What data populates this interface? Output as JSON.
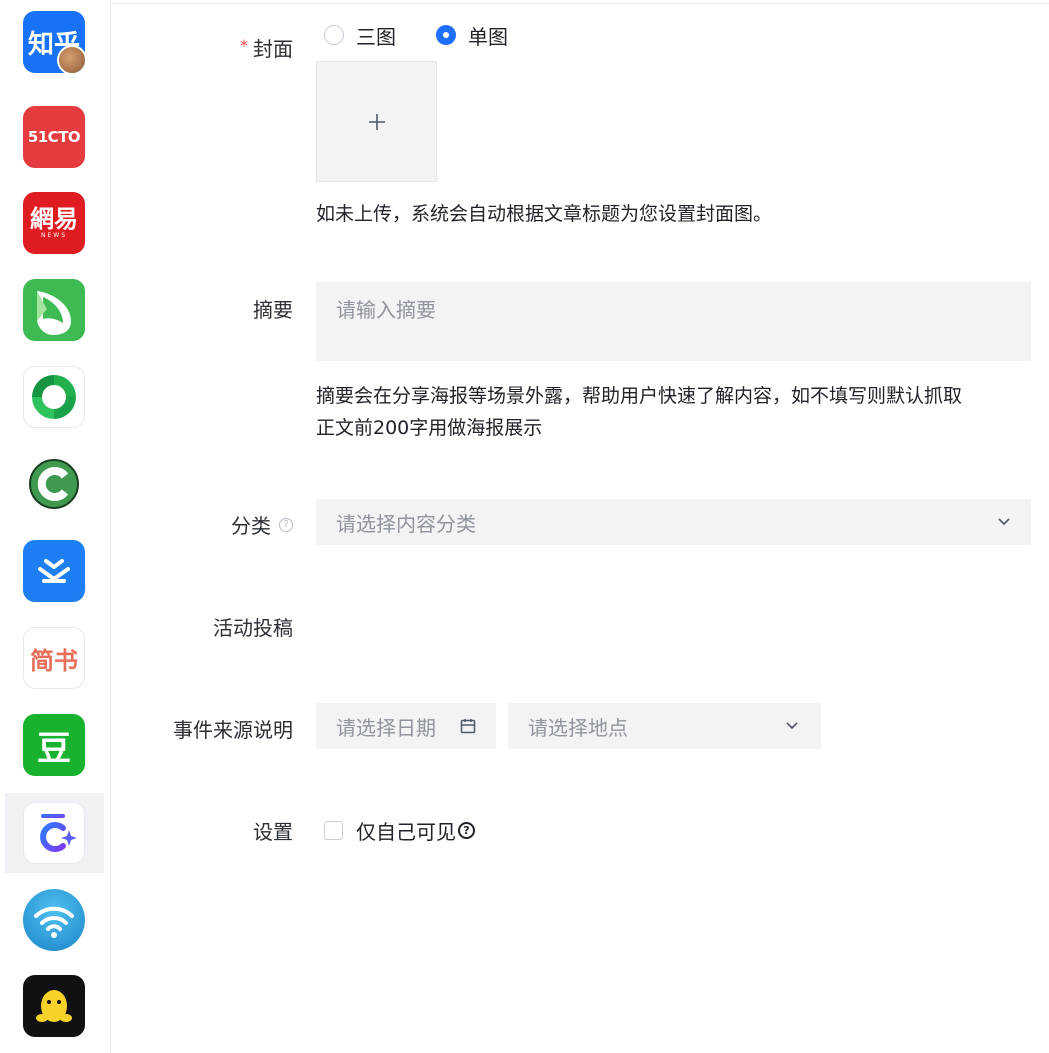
{
  "sidebar": {
    "items": [
      {
        "name": "zhihu",
        "label": "知乎",
        "bg": "#1772f6",
        "fg": "#ffffff"
      },
      {
        "name": "51cto",
        "label": "51CTO",
        "bg": "#e53b3f",
        "fg": "#ffffff"
      },
      {
        "name": "netease",
        "label": "網易",
        "sublabel": "NEWS",
        "bg": "#df1c21",
        "fg": "#ffffff"
      },
      {
        "name": "bird",
        "bg": "#3dbb52",
        "fg": "#ffffff"
      },
      {
        "name": "swirl",
        "bg": "#ffffff",
        "fg": "#21b04d"
      },
      {
        "name": "c-logo",
        "label": "C",
        "bg": "#ffffff",
        "fg": "#3f9a4f"
      },
      {
        "name": "layers",
        "bg": "#1e7ff5",
        "fg": "#ffffff"
      },
      {
        "name": "jianshu",
        "label": "简书",
        "bg": "#ffffff",
        "fg": "#ea6f5a"
      },
      {
        "name": "douban",
        "label": "豆",
        "bg": "#19b22e",
        "fg": "#ffffff"
      },
      {
        "name": "c-sparkle",
        "bg": "#ffffff",
        "fg": "#3b5bfd"
      },
      {
        "name": "wifi",
        "bg": "#2ea0e0",
        "fg": "#ffffff"
      },
      {
        "name": "qq",
        "bg": "#111111",
        "fg": "#f7d229"
      }
    ]
  },
  "form": {
    "cover": {
      "label": "封面",
      "required_mark": "*",
      "options": [
        "三图",
        "单图"
      ],
      "selected_index": 1,
      "upload_icon": "plus-icon",
      "hint": "如未上传，系统会自动根据文章标题为您设置封面图。"
    },
    "summary": {
      "label": "摘要",
      "placeholder": "请输入摘要",
      "value": "",
      "hint_line1": "摘要会在分享海报等场景外露，帮助用户快速了解内容，如不填写则默认抓取",
      "hint_line2": "正文前200字用做海报展示"
    },
    "category": {
      "label": "分类",
      "help_glyph": "?",
      "placeholder": "请选择内容分类"
    },
    "activity": {
      "label": "活动投稿"
    },
    "event_source": {
      "label": "事件来源说明",
      "date_placeholder": "请选择日期",
      "location_placeholder": "请选择地点"
    },
    "settings": {
      "label": "设置",
      "checkbox_label": "仅自己可见",
      "checked": false,
      "help_glyph": "?"
    }
  },
  "colors": {
    "accent": "#1e6fff",
    "required": "#f54a45",
    "field_bg": "#f2f3f5",
    "placeholder": "#8f959e"
  }
}
